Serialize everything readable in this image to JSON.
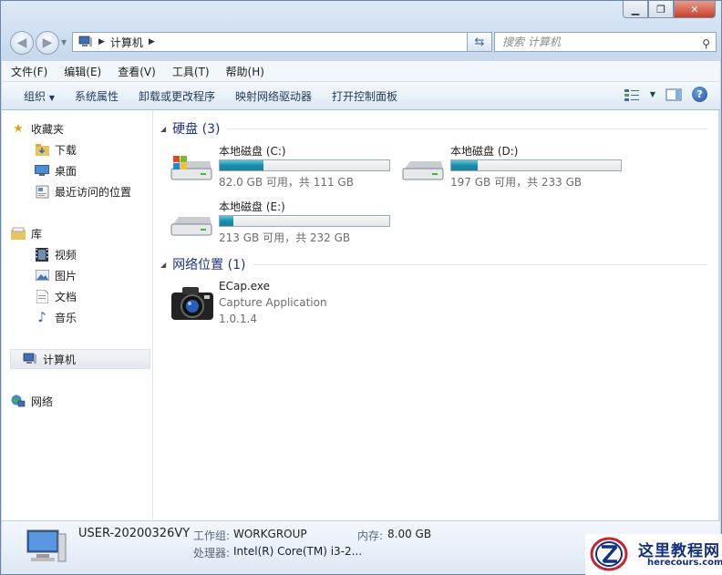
{
  "address": {
    "location": "计算机",
    "search_placeholder": "搜索 计算机"
  },
  "menu": [
    "文件(F)",
    "编辑(E)",
    "查看(V)",
    "工具(T)",
    "帮助(H)"
  ],
  "commands": [
    "组织",
    "系统属性",
    "卸载或更改程序",
    "映射网络驱动器",
    "打开控制面板"
  ],
  "sidebar": {
    "favorites": "收藏夹",
    "downloads": "下载",
    "desktop": "桌面",
    "recent": "最近访问的位置",
    "libraries": "库",
    "videos": "视频",
    "pictures": "图片",
    "documents": "文档",
    "music": "音乐",
    "computer": "计算机",
    "network": "网络"
  },
  "hard_drives": {
    "header": "硬盘 (3)",
    "drives": [
      {
        "name": "本地磁盘 (C:)",
        "info": "82.0 GB 可用，共 111 GB",
        "used_fraction": 0.26
      },
      {
        "name": "本地磁盘 (D:)",
        "info": "197 GB 可用，共 233 GB",
        "used_fraction": 0.155
      },
      {
        "name": "本地磁盘 (E:)",
        "info": "213 GB 可用，共 232 GB",
        "used_fraction": 0.08
      }
    ]
  },
  "network_locations": {
    "header": "网络位置 (1)",
    "item": {
      "name": "ECap.exe",
      "description": "Capture Application",
      "version": "1.0.1.4"
    }
  },
  "details": {
    "pc_name": "USER-20200326VY",
    "workgroup_label": "工作组:",
    "workgroup": "WORKGROUP",
    "memory_label": "内存:",
    "memory": "8.00 GB",
    "processor_label": "处理器:",
    "processor": "Intel(R) Core(TM) i3-2..."
  },
  "watermark": {
    "cn": "这里教程网",
    "en": "herecours.com"
  },
  "colors": {
    "group_header": "#1e3287",
    "drive_bar": "#1a8eae",
    "selection": "#e4e8ee"
  }
}
